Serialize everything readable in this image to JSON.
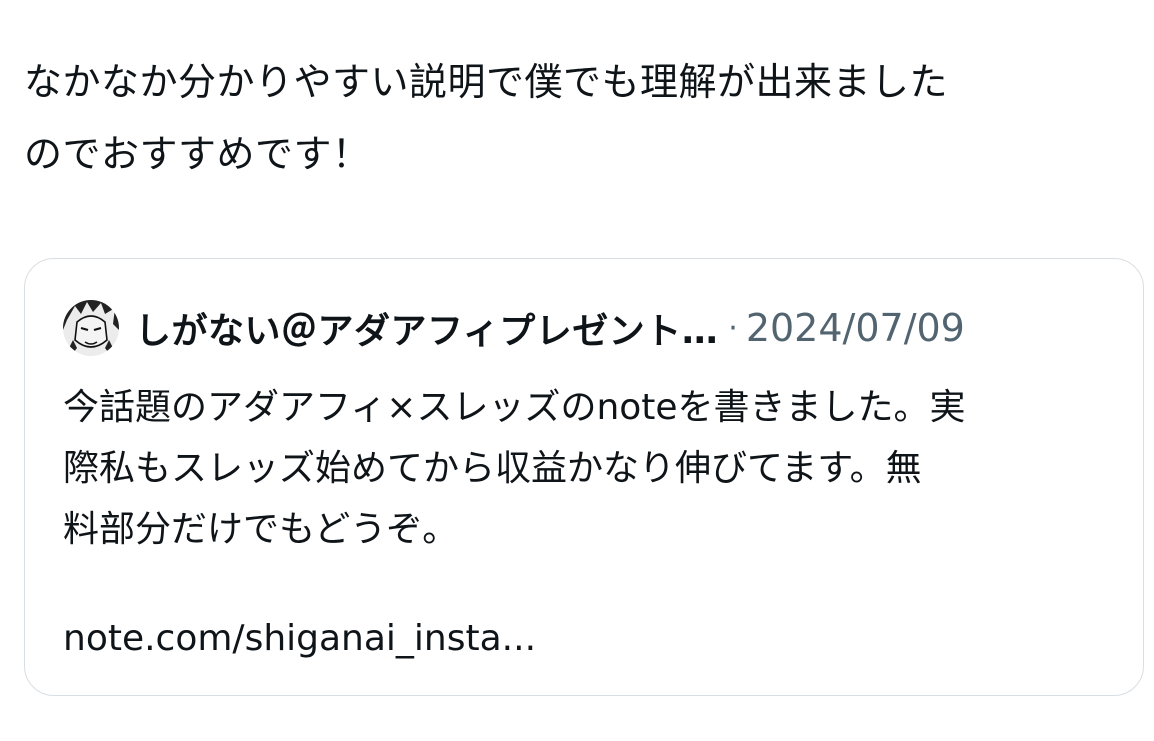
{
  "post": {
    "text": "なかなか分かりやすい説明で僕でも理解が出来ました\nのでおすすめです！"
  },
  "quote": {
    "author_name": "しがない＠アダアフィプレゼント…",
    "separator": "·",
    "date": "2024/07/09",
    "body": "今話題のアダアフィ×スレッズのnoteを書きました。実\n際私もスレッズ始めてから収益かなり伸びてます。無\n料部分だけでもどうぞ。",
    "link_text": "note.com/shiganai_insta..."
  }
}
